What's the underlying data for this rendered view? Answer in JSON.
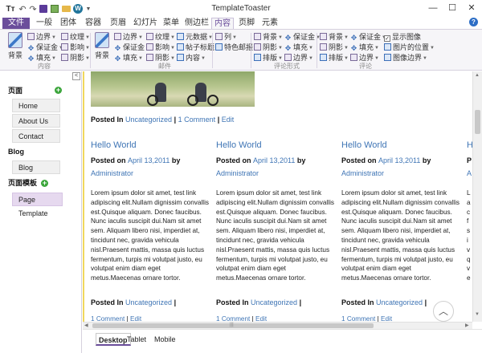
{
  "app": {
    "title": "TemplateToaster",
    "logo_text": "Tт",
    "quick_access": [
      "undo-icon",
      "redo-icon",
      "save-icon",
      "image-icon",
      "folder-icon",
      "wordpress-icon",
      "dropdown-arrow-icon"
    ],
    "window_controls": [
      "minimize",
      "maximize",
      "close"
    ],
    "wp_letter": "W"
  },
  "menu": {
    "tabs": [
      {
        "label": "文件",
        "state": "file"
      },
      {
        "label": "一般"
      },
      {
        "label": "团体"
      },
      {
        "label": "容器"
      },
      {
        "label": "页眉"
      },
      {
        "label": "幻灯片"
      },
      {
        "label": "菜单"
      },
      {
        "label": "侧边栏"
      },
      {
        "label": "内容",
        "state": "active"
      },
      {
        "label": "页脚"
      },
      {
        "label": "元素"
      }
    ],
    "help": "?"
  },
  "ribbon": {
    "group1": {
      "big_label": "背景",
      "items": [
        "边界",
        "纹理",
        "保证金",
        "影响",
        "填充",
        "阴影"
      ],
      "label": "内容"
    },
    "group2": {
      "big_label": "背景",
      "items": [
        "边界",
        "纹理",
        "元数据",
        "保证金",
        "影响",
        "帖子标题",
        "填充",
        "阴影",
        "内容"
      ],
      "label": "邮件"
    },
    "group3": {
      "items": [
        "列",
        "特色邮报"
      ]
    },
    "group4": {
      "items": [
        "背景",
        "保证金",
        "阴影",
        "填充",
        "排版",
        "边界"
      ],
      "label": "评论形式"
    },
    "group5": {
      "items": [
        "背景",
        "保证金",
        "显示图像",
        "阴影",
        "填充",
        "图片的位置",
        "排版",
        "边界",
        "图像边界"
      ],
      "label": "评论"
    },
    "colors": {
      "accent": "#6b4e9b",
      "link": "#3f75b5"
    }
  },
  "left_panel": {
    "sections": [
      {
        "heading": "页面",
        "items": [
          "Home",
          "About Us",
          "Contact"
        ],
        "add": true
      },
      {
        "heading": "Blog",
        "items": [
          "Blog"
        ],
        "add": false
      },
      {
        "heading": "页面模板",
        "items": [
          "Page Template"
        ],
        "add": true
      }
    ],
    "collapse_label": "<"
  },
  "canvas": {
    "top_posted": {
      "label": "Posted In",
      "links": [
        "Uncategorized",
        "1 Comment",
        "Edit"
      ]
    },
    "columns": [
      {
        "title": "Hello World",
        "posted_on": "Posted on",
        "date": "April 13,2011",
        "by": "by",
        "author": "Administrator",
        "body": "Lorem ipsum dolor sit amet, test link adipiscing elit.Nullam dignissim convallis est.Quisque aliquam. Donec faucibus. Nunc iaculis suscipit dui.Nam sit amet sem. Aliquam libero nisi, imperdiet at, tincidunt nec, gravida vehicula nisl.Praesent mattis, massa quis luctus fermentum, turpis mi volutpat justo, eu volutpat enim diam eget metus.Maecenas ornare tortor.",
        "posted_in": "Posted In",
        "category": "Uncategorized",
        "comment": "1 Comment",
        "edit": "Edit"
      },
      {
        "title": "Hello World",
        "posted_on": "Posted on",
        "date": "April 13,2011",
        "by": "by",
        "author": "Administrator",
        "body": "Lorem ipsum dolor sit amet, test link adipiscing elit.Nullam dignissim convallis est.Quisque aliquam. Donec faucibus. Nunc iaculis suscipit dui.Nam sit amet sem. Aliquam libero nisi, imperdiet at, tincidunt nec, gravida vehicula nisl.Praesent mattis, massa quis luctus fermentum, turpis mi volutpat justo, eu volutpat enim diam eget metus.Maecenas ornare tortor.",
        "posted_in": "Posted In",
        "category": "Uncategorized",
        "comment": "1 Comment",
        "edit": "Edit"
      },
      {
        "title": "Hello World",
        "posted_on": "Posted on",
        "date": "April 13,2011",
        "by": "by",
        "author": "Administrator",
        "body": "Lorem ipsum dolor sit amet, test link adipiscing elit.Nullam dignissim convallis est.Quisque aliquam. Donec faucibus. Nunc iaculis suscipit dui.Nam sit amet sem. Aliquam libero nisi, imperdiet at, tincidunt nec, gravida vehicula nisl.Praesent mattis, massa quis luctus fermentum, turpis mi volutpat justo, eu volutpat enim diam eget metus.Maecenas ornare tortor.",
        "posted_in": "Posted In",
        "category": "Uncategorized",
        "comment": "1 Comment",
        "edit": "Edit"
      }
    ],
    "partial_column": {
      "title": "H",
      "meta": "P",
      "author": "A",
      "body": [
        "L",
        "a",
        "c",
        "f",
        "s",
        "i",
        "v",
        "q",
        "v",
        "e"
      ],
      "posted_in": "P",
      "comment": "1"
    },
    "scroll_top_icon": "chevron-up-icon"
  },
  "view_tabs": [
    {
      "label": "Desktop",
      "active": true
    },
    {
      "label": "Tablet"
    },
    {
      "label": "Mobile"
    }
  ]
}
